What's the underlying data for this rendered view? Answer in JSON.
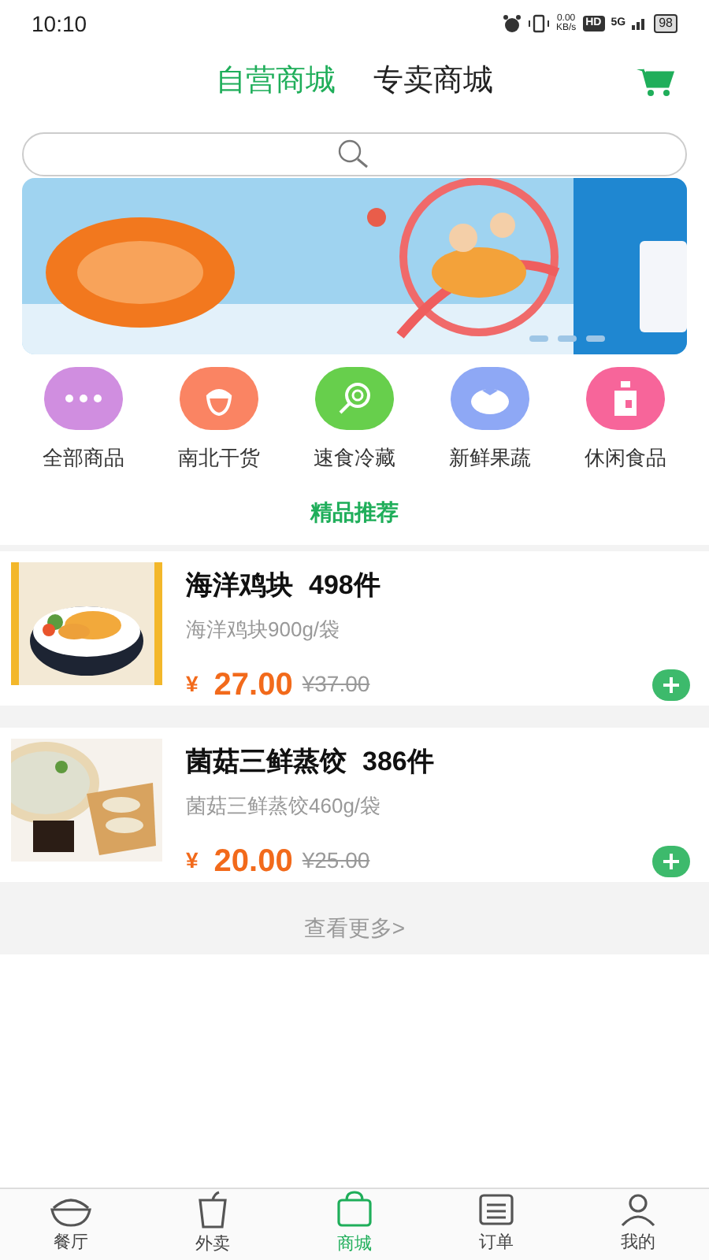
{
  "status_bar": {
    "time": "10:10",
    "net_speed": "0.00",
    "net_unit": "KB/s",
    "hd": "HD",
    "network": "5G",
    "battery": "98"
  },
  "header": {
    "tabs": [
      {
        "label": "自营商城",
        "selected": true
      },
      {
        "label": "专卖商城",
        "selected": false
      }
    ]
  },
  "banner": {
    "dots": [
      {
        "selected": false
      },
      {
        "selected": false
      },
      {
        "selected": false
      }
    ]
  },
  "categories": [
    {
      "label": "全部商品",
      "kind": "more",
      "color": "#d08ee0"
    },
    {
      "label": "南北干货",
      "kind": "nut",
      "color": "#fa8463"
    },
    {
      "label": "速食冷藏",
      "kind": "lollipop",
      "color": "#67cf4c"
    },
    {
      "label": "新鲜果蔬",
      "kind": "tomato",
      "color": "#8ea8f5"
    },
    {
      "label": "休闲食品",
      "kind": "bottle",
      "color": "#f7659a"
    }
  ],
  "section_title": "精品推荐",
  "products": [
    {
      "name": "海洋鸡块",
      "stock": "498件",
      "spec": "海洋鸡块900g/袋",
      "currency": "¥",
      "price": "27.00",
      "original_price": "¥37.00",
      "kind": "nuggets"
    },
    {
      "name": "菌菇三鲜蒸饺",
      "stock": "386件",
      "spec": "菌菇三鲜蒸饺460g/袋",
      "currency": "¥",
      "price": "20.00",
      "original_price": "¥25.00",
      "kind": "dumplings"
    }
  ],
  "more_link": "查看更多>",
  "tab_bar": [
    {
      "label": "餐厅",
      "kind": "bowl",
      "selected": false
    },
    {
      "label": "外卖",
      "kind": "bag",
      "selected": false
    },
    {
      "label": "商城",
      "kind": "shop",
      "selected": true
    },
    {
      "label": "订单",
      "kind": "list",
      "selected": false
    },
    {
      "label": "我的",
      "kind": "person",
      "selected": false
    }
  ]
}
